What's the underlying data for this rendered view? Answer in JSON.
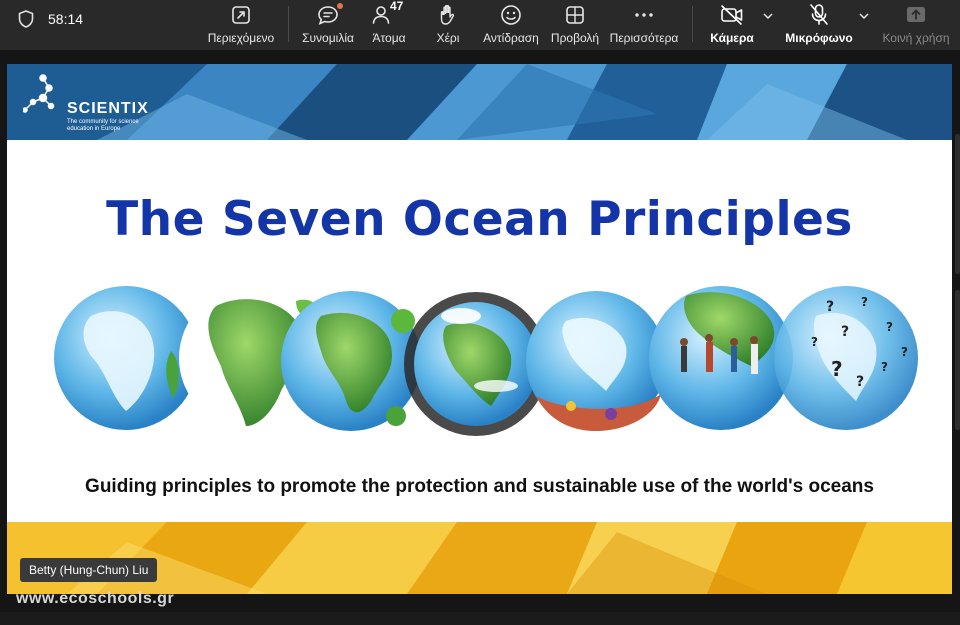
{
  "meeting": {
    "elapsed": "58:14",
    "participants_count": "47"
  },
  "toolbar": {
    "content": "Περιεχόμενο",
    "chat": "Συνομιλία",
    "people": "Άτομα",
    "hand": "Χέρι",
    "reaction": "Αντίδραση",
    "view": "Προβολή",
    "more": "Περισσότερα",
    "camera": "Κάμερα",
    "mic": "Μικρόφωνο",
    "share": "Κοινή χρήση"
  },
  "slide": {
    "logo_name": "SCIENTIX",
    "logo_tagline": "The community for science education in Europe",
    "title": "The Seven Ocean Principles",
    "subtitle": "Guiding principles to promote the protection and sustainable use of the world's oceans"
  },
  "presenter_name": "Betty (Hung-Chun) Liu",
  "watermark": "www.ecoschools.gr",
  "colors": {
    "toolbar_bg": "#292929",
    "slide_title": "#1335a8",
    "header_blue": "#2a6fa8",
    "footer_yellow": "#f2b418",
    "notification_dot": "#e8744f"
  },
  "icons": [
    "shield-icon",
    "share-content-icon",
    "chat-icon",
    "people-icon",
    "raise-hand-icon",
    "reaction-icon",
    "view-icon",
    "more-icon",
    "camera-off-icon",
    "mic-off-icon",
    "share-tray-icon",
    "chevron-down-icon"
  ]
}
